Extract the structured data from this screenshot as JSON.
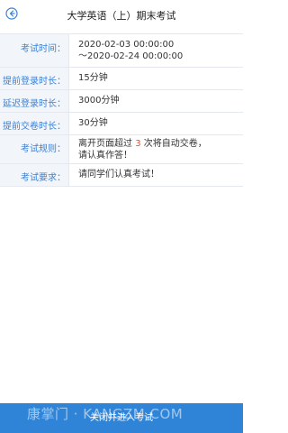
{
  "header": {
    "title": "大学英语（上）期末考试",
    "back_icon": "back-arrow-circle-icon"
  },
  "info": {
    "exam_time_label": "考试时间：",
    "exam_time_start": "2020-02-03 00:00:00",
    "exam_time_end": "～2020-02-24 00:00:00",
    "early_login_label": "提前登录时长：",
    "early_login_value": "15分钟",
    "late_login_label": "延迟登录时长：",
    "late_login_value": "3000分钟",
    "early_submit_label": "提前交卷时长：",
    "early_submit_value": "30分钟",
    "rules_label": "考试规则：",
    "rules_part1": "离开页面超过 ",
    "rules_count": "3",
    "rules_part2": " 次将自动交卷，",
    "rules_line2": "请认真作答！",
    "requirement_label": "考试要求：",
    "requirement_value": "请同学们认真考试！"
  },
  "bottom": {
    "button_label": "关闭并进入考试"
  },
  "watermark": "康掌门 · KANGZM.COM",
  "colors": {
    "accent": "#3b82d6",
    "bottom_bar": "#2f84d8",
    "highlight": "#e8502c",
    "label_bg": "#f2f5fa"
  }
}
